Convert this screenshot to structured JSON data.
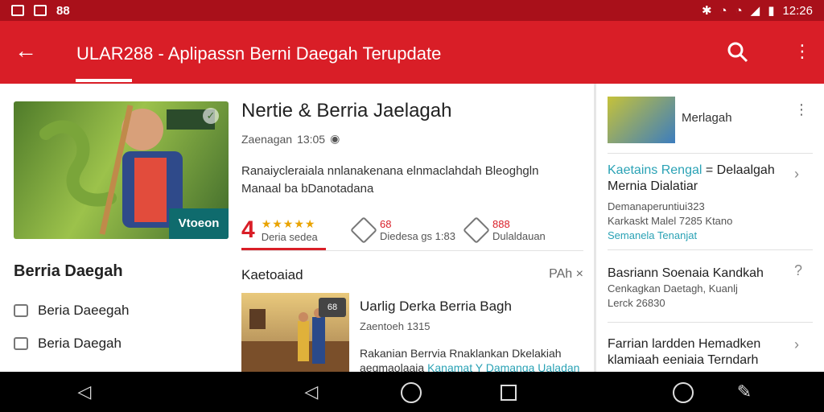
{
  "status_bar": {
    "left_label": "88",
    "time": "12:26"
  },
  "app_bar": {
    "title": "ULAR288 - Aplipassn Berni Daegah Terupdate",
    "back_icon": "back-arrow-icon",
    "search_icon": "search-icon",
    "more_icon": "more-vert-icon"
  },
  "hero": {
    "tag": "Vtoeon",
    "check_icon": "check-icon"
  },
  "sidebar": {
    "heading": "Berria Daegah",
    "items": [
      {
        "label": "Beria Daeegah",
        "icon": "doc-icon"
      },
      {
        "label": "Beria Daegah",
        "icon": "doc-icon"
      }
    ]
  },
  "main": {
    "title": "Nertie & Berria Jaelagah",
    "meta": "Zaenagan",
    "meta_time": "13:05",
    "description": "Ranaiycleraiala nnlanakenana elnmaclahdah Bleoghgln Manaal ba bDanotadana",
    "stats": [
      {
        "value": "4",
        "stars": "★★★★★",
        "label": "Deria sedea"
      },
      {
        "value": "68",
        "label": "Diedesa gs 1:83"
      },
      {
        "value": "888",
        "label": "Dulaldauan"
      }
    ],
    "section_label": "Kaetoaiad",
    "section_action": "PAh",
    "section_close": "×",
    "card": {
      "badge": "68",
      "title": "Uarlig Derka Berria Bagh",
      "meta": "Zaentoeh",
      "meta_time": "1315",
      "desc_plain": "Rakanian Berrvia Rnaklankan Dkelakiah aegmaolaaia ",
      "desc_link": "Kanamat Y Damanga Ualadan"
    }
  },
  "right": {
    "head": "Merlagah",
    "items": [
      {
        "title_teal": "Kaetains Rengal",
        "title_rest": " = Delaalgah Mernia Dialatiar",
        "sub": "Demanaperuntiui323",
        "sub2": "Karkaskt Malel 7285 Ktano",
        "sub3": "Semanela Tenanjat"
      },
      {
        "title": "Basriann Soenaia Kandkah",
        "sub": "Cenkagkan Daetagh, Kuanlj",
        "sub2": "Lerck 26830"
      },
      {
        "title": "Farrian lardden Hemadken klamiaah eeniaia Terndarh"
      }
    ]
  },
  "nav": {
    "back": "◁",
    "home": "○",
    "recent": "□"
  }
}
